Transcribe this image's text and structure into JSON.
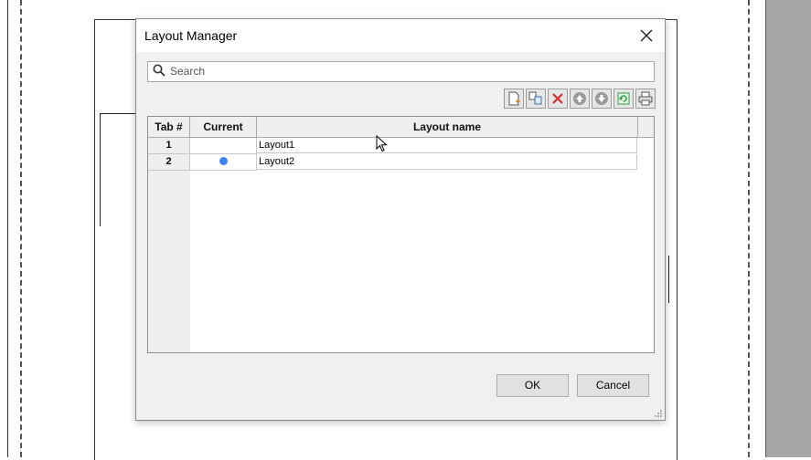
{
  "dialog": {
    "title": "Layout Manager",
    "close_symbol": "✕"
  },
  "search": {
    "placeholder": "Search",
    "icon": "search-icon"
  },
  "toolbar": {
    "buttons": [
      {
        "name": "new-layout-icon",
        "color": "#d08a2a"
      },
      {
        "name": "copy-layout-icon",
        "color": "#3a6fb0"
      },
      {
        "name": "delete-icon",
        "color": "#d32f2f"
      },
      {
        "name": "move-up-icon",
        "color": "#888888"
      },
      {
        "name": "move-down-icon",
        "color": "#888888"
      },
      {
        "name": "refresh-icon",
        "color": "#2e9e3e"
      },
      {
        "name": "print-icon",
        "color": "#555555"
      }
    ]
  },
  "table": {
    "headers": {
      "tab": "Tab #",
      "current": "Current",
      "name": "Layout name"
    },
    "rows": [
      {
        "tab": "1",
        "current": false,
        "name": "Layout1"
      },
      {
        "tab": "2",
        "current": true,
        "name": "Layout2"
      }
    ]
  },
  "buttons": {
    "ok": "OK",
    "cancel": "Cancel"
  },
  "colors": {
    "current_dot": "#3b82f6"
  }
}
